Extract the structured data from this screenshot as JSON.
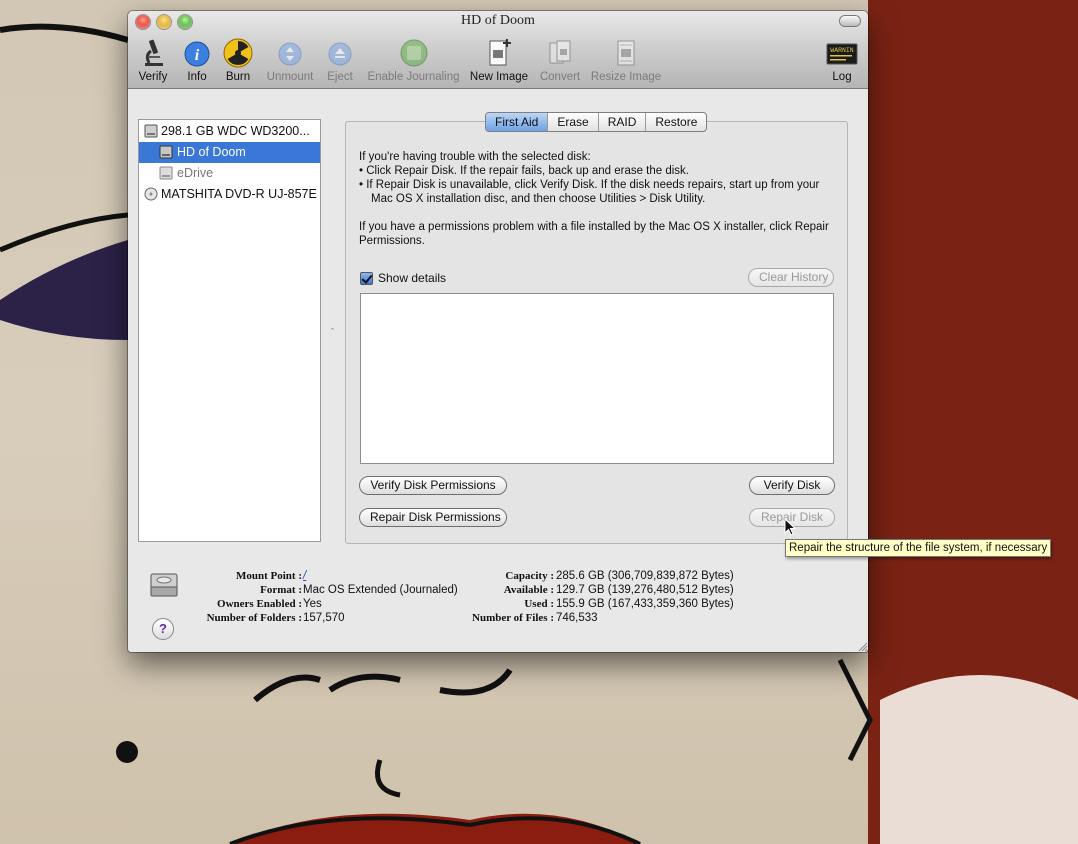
{
  "window": {
    "title": "HD of Doom"
  },
  "toolbar": {
    "items": [
      {
        "label": "Verify",
        "icon": "microscope-icon",
        "enabled": true
      },
      {
        "label": "Info",
        "icon": "info-icon",
        "enabled": true
      },
      {
        "label": "Burn",
        "icon": "radiation-icon",
        "enabled": true
      },
      {
        "label": "Unmount",
        "icon": "unmount-icon",
        "enabled": false
      },
      {
        "label": "Eject",
        "icon": "eject-icon",
        "enabled": false
      },
      {
        "label": "Enable Journaling",
        "icon": "journal-icon",
        "enabled": false
      },
      {
        "label": "New Image",
        "icon": "new-image-icon",
        "enabled": true
      },
      {
        "label": "Convert",
        "icon": "convert-icon",
        "enabled": false
      },
      {
        "label": "Resize Image",
        "icon": "resize-image-icon",
        "enabled": false
      },
      {
        "label": "Log",
        "icon": "log-icon",
        "enabled": true
      }
    ],
    "log_icon_text": "WARNIN"
  },
  "sidebar": {
    "items": [
      {
        "label": "298.1 GB WDC WD3200...",
        "icon": "hard-disk-icon",
        "selected": false,
        "dim": false
      },
      {
        "label": "HD of Doom",
        "icon": "volume-icon",
        "selected": true,
        "dim": false
      },
      {
        "label": "eDrive",
        "icon": "volume-icon",
        "selected": false,
        "dim": true
      },
      {
        "label": "MATSHITA DVD-R UJ-857E",
        "icon": "optical-drive-icon",
        "selected": false,
        "dim": false
      }
    ]
  },
  "tabs": [
    {
      "label": "First Aid",
      "active": true
    },
    {
      "label": "Erase",
      "active": false
    },
    {
      "label": "RAID",
      "active": false
    },
    {
      "label": "Restore",
      "active": false
    }
  ],
  "first_aid": {
    "intro": "If you're having trouble with the selected disk:",
    "bullet1": "• Click Repair Disk. If the repair fails, back up and erase the disk.",
    "bullet2": "• If Repair Disk is unavailable, click Verify Disk. If the disk needs repairs, start up from your Mac OS X installation disc, and then choose Utilities > Disk Utility.",
    "permissions_note": "If you have a permissions problem with a file installed by the Mac OS X installer, click Repair Permissions.",
    "show_details_label": "Show details",
    "show_details_checked": true,
    "clear_history_label": "Clear History",
    "verify_permissions_label": "Verify Disk Permissions",
    "repair_permissions_label": "Repair Disk Permissions",
    "verify_disk_label": "Verify Disk",
    "repair_disk_label": "Repair Disk"
  },
  "disk_info": {
    "mount_point_key": "Mount Point :",
    "mount_point_value": "/",
    "format_key": "Format :",
    "format_value": "Mac OS Extended (Journaled)",
    "owners_key": "Owners Enabled :",
    "owners_value": "Yes",
    "folders_key": "Number of Folders :",
    "folders_value": "157,570",
    "capacity_key": "Capacity :",
    "capacity_value": "285.6 GB (306,709,839,872 Bytes)",
    "available_key": "Available :",
    "available_value": "129.7 GB (139,276,480,512 Bytes)",
    "used_key": "Used :",
    "used_value": "155.9 GB (167,433,359,360 Bytes)",
    "files_key": "Number of Files :",
    "files_value": "746,533",
    "help_label": "?"
  },
  "tooltip": {
    "text": "Repair the structure of the file system, if necessary"
  },
  "colors": {
    "selection": "#3b77d7",
    "active_tab": "#6fa2e4",
    "tooltip_bg": "#ffffc6",
    "wallpaper_red": "#7a2314"
  }
}
